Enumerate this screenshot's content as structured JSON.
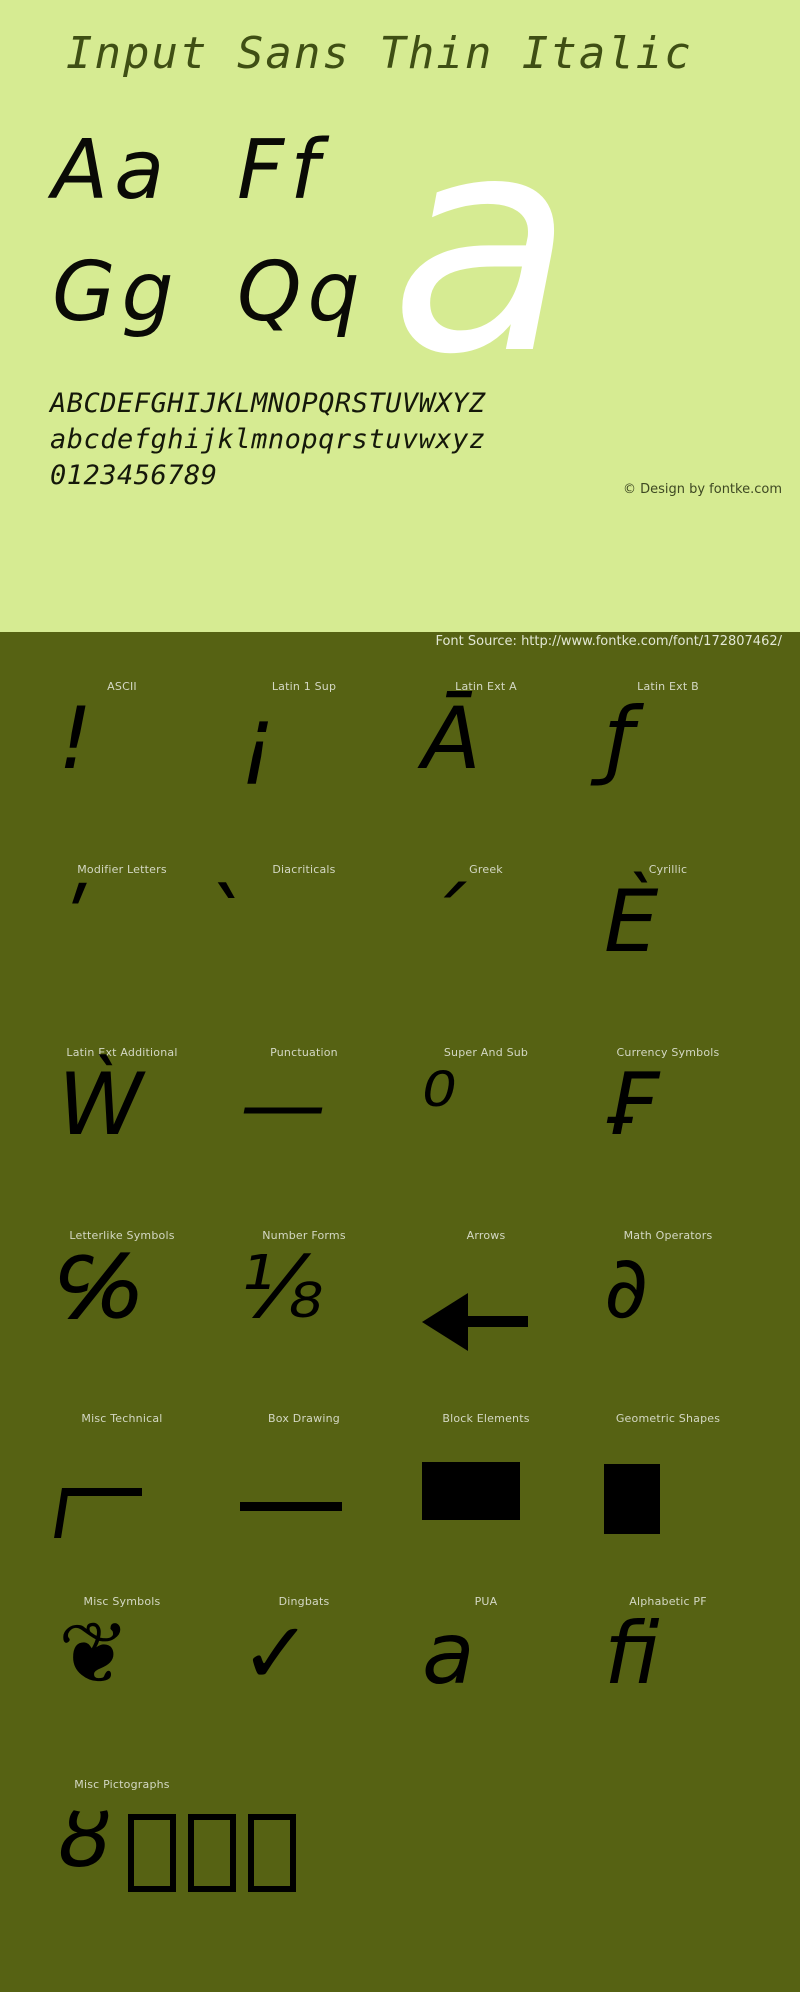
{
  "specimen": {
    "title": "Input Sans Thin Italic",
    "hero_glyph": "a",
    "letter_pairs": [
      "Aa",
      "Ff",
      "Gg",
      "Qq"
    ],
    "charset_lines": [
      "ABCDEFGHIJKLMNOPQRSTUVWXYZ",
      "abcdefghijklmnopqrstuvwxyz",
      "0123456789"
    ],
    "design_credit": "© Design by fontke.com",
    "source_line": "Font Source: http://www.fontke.com/font/172807462/"
  },
  "colors": {
    "panel_light": "#d6eb92",
    "panel_dark": "#566213",
    "title_text": "#3f4f14",
    "glyph_black": "#000000",
    "hero_white": "#ffffff",
    "label_text": "#d4d8c4"
  },
  "unicode_blocks": [
    [
      {
        "label": "ASCII",
        "glyph": "!",
        "render": "text"
      },
      {
        "label": "Latin 1 Sup",
        "glyph": "¡",
        "render": "text"
      },
      {
        "label": "Latin Ext A",
        "glyph": "Ā",
        "render": "text"
      },
      {
        "label": "Latin Ext B",
        "glyph": "ƒ",
        "render": "text"
      }
    ],
    [
      {
        "label": "Modifier Letters",
        "glyph": "ʹ",
        "render": "text"
      },
      {
        "label": "Diacriticals",
        "glyph": "̀",
        "render": "text"
      },
      {
        "label": "Greek",
        "glyph": "΄",
        "render": "text"
      },
      {
        "label": "Cyrillic",
        "glyph": "Ѐ",
        "render": "text"
      }
    ],
    [
      {
        "label": "Latin Ext Additional",
        "glyph": "Ẁ",
        "render": "text"
      },
      {
        "label": "Punctuation",
        "glyph": "—",
        "render": "text"
      },
      {
        "label": "Super And Sub",
        "glyph": "⁰",
        "render": "text"
      },
      {
        "label": "Currency Symbols",
        "glyph": "₣",
        "render": "text"
      }
    ],
    [
      {
        "label": "Letterlike Symbols",
        "glyph": "℅",
        "render": "text"
      },
      {
        "label": "Number Forms",
        "glyph": "⅛",
        "render": "text"
      },
      {
        "label": "Arrows",
        "glyph": "←",
        "render": "arrow"
      },
      {
        "label": "Math Operators",
        "glyph": "∂",
        "render": "text"
      }
    ],
    [
      {
        "label": "Misc Technical",
        "glyph": "⌐",
        "render": "misc-tech"
      },
      {
        "label": "Box Drawing",
        "glyph": "─",
        "render": "box-draw"
      },
      {
        "label": "Block Elements",
        "glyph": "█",
        "render": "block-el"
      },
      {
        "label": "Geometric Shapes",
        "glyph": "■",
        "render": "geom"
      }
    ],
    [
      {
        "label": "Misc Symbols",
        "glyph": "❦",
        "render": "text"
      },
      {
        "label": "Dingbats",
        "glyph": "✓",
        "render": "text"
      },
      {
        "label": "PUA",
        "glyph": "a",
        "render": "text"
      },
      {
        "label": "Alphabetic PF",
        "glyph": "ﬁ",
        "render": "text"
      }
    ],
    [
      {
        "label": "Misc Pictographs",
        "glyph": "ȣ",
        "render": "pictographs"
      }
    ]
  ],
  "tofu_count": 3
}
